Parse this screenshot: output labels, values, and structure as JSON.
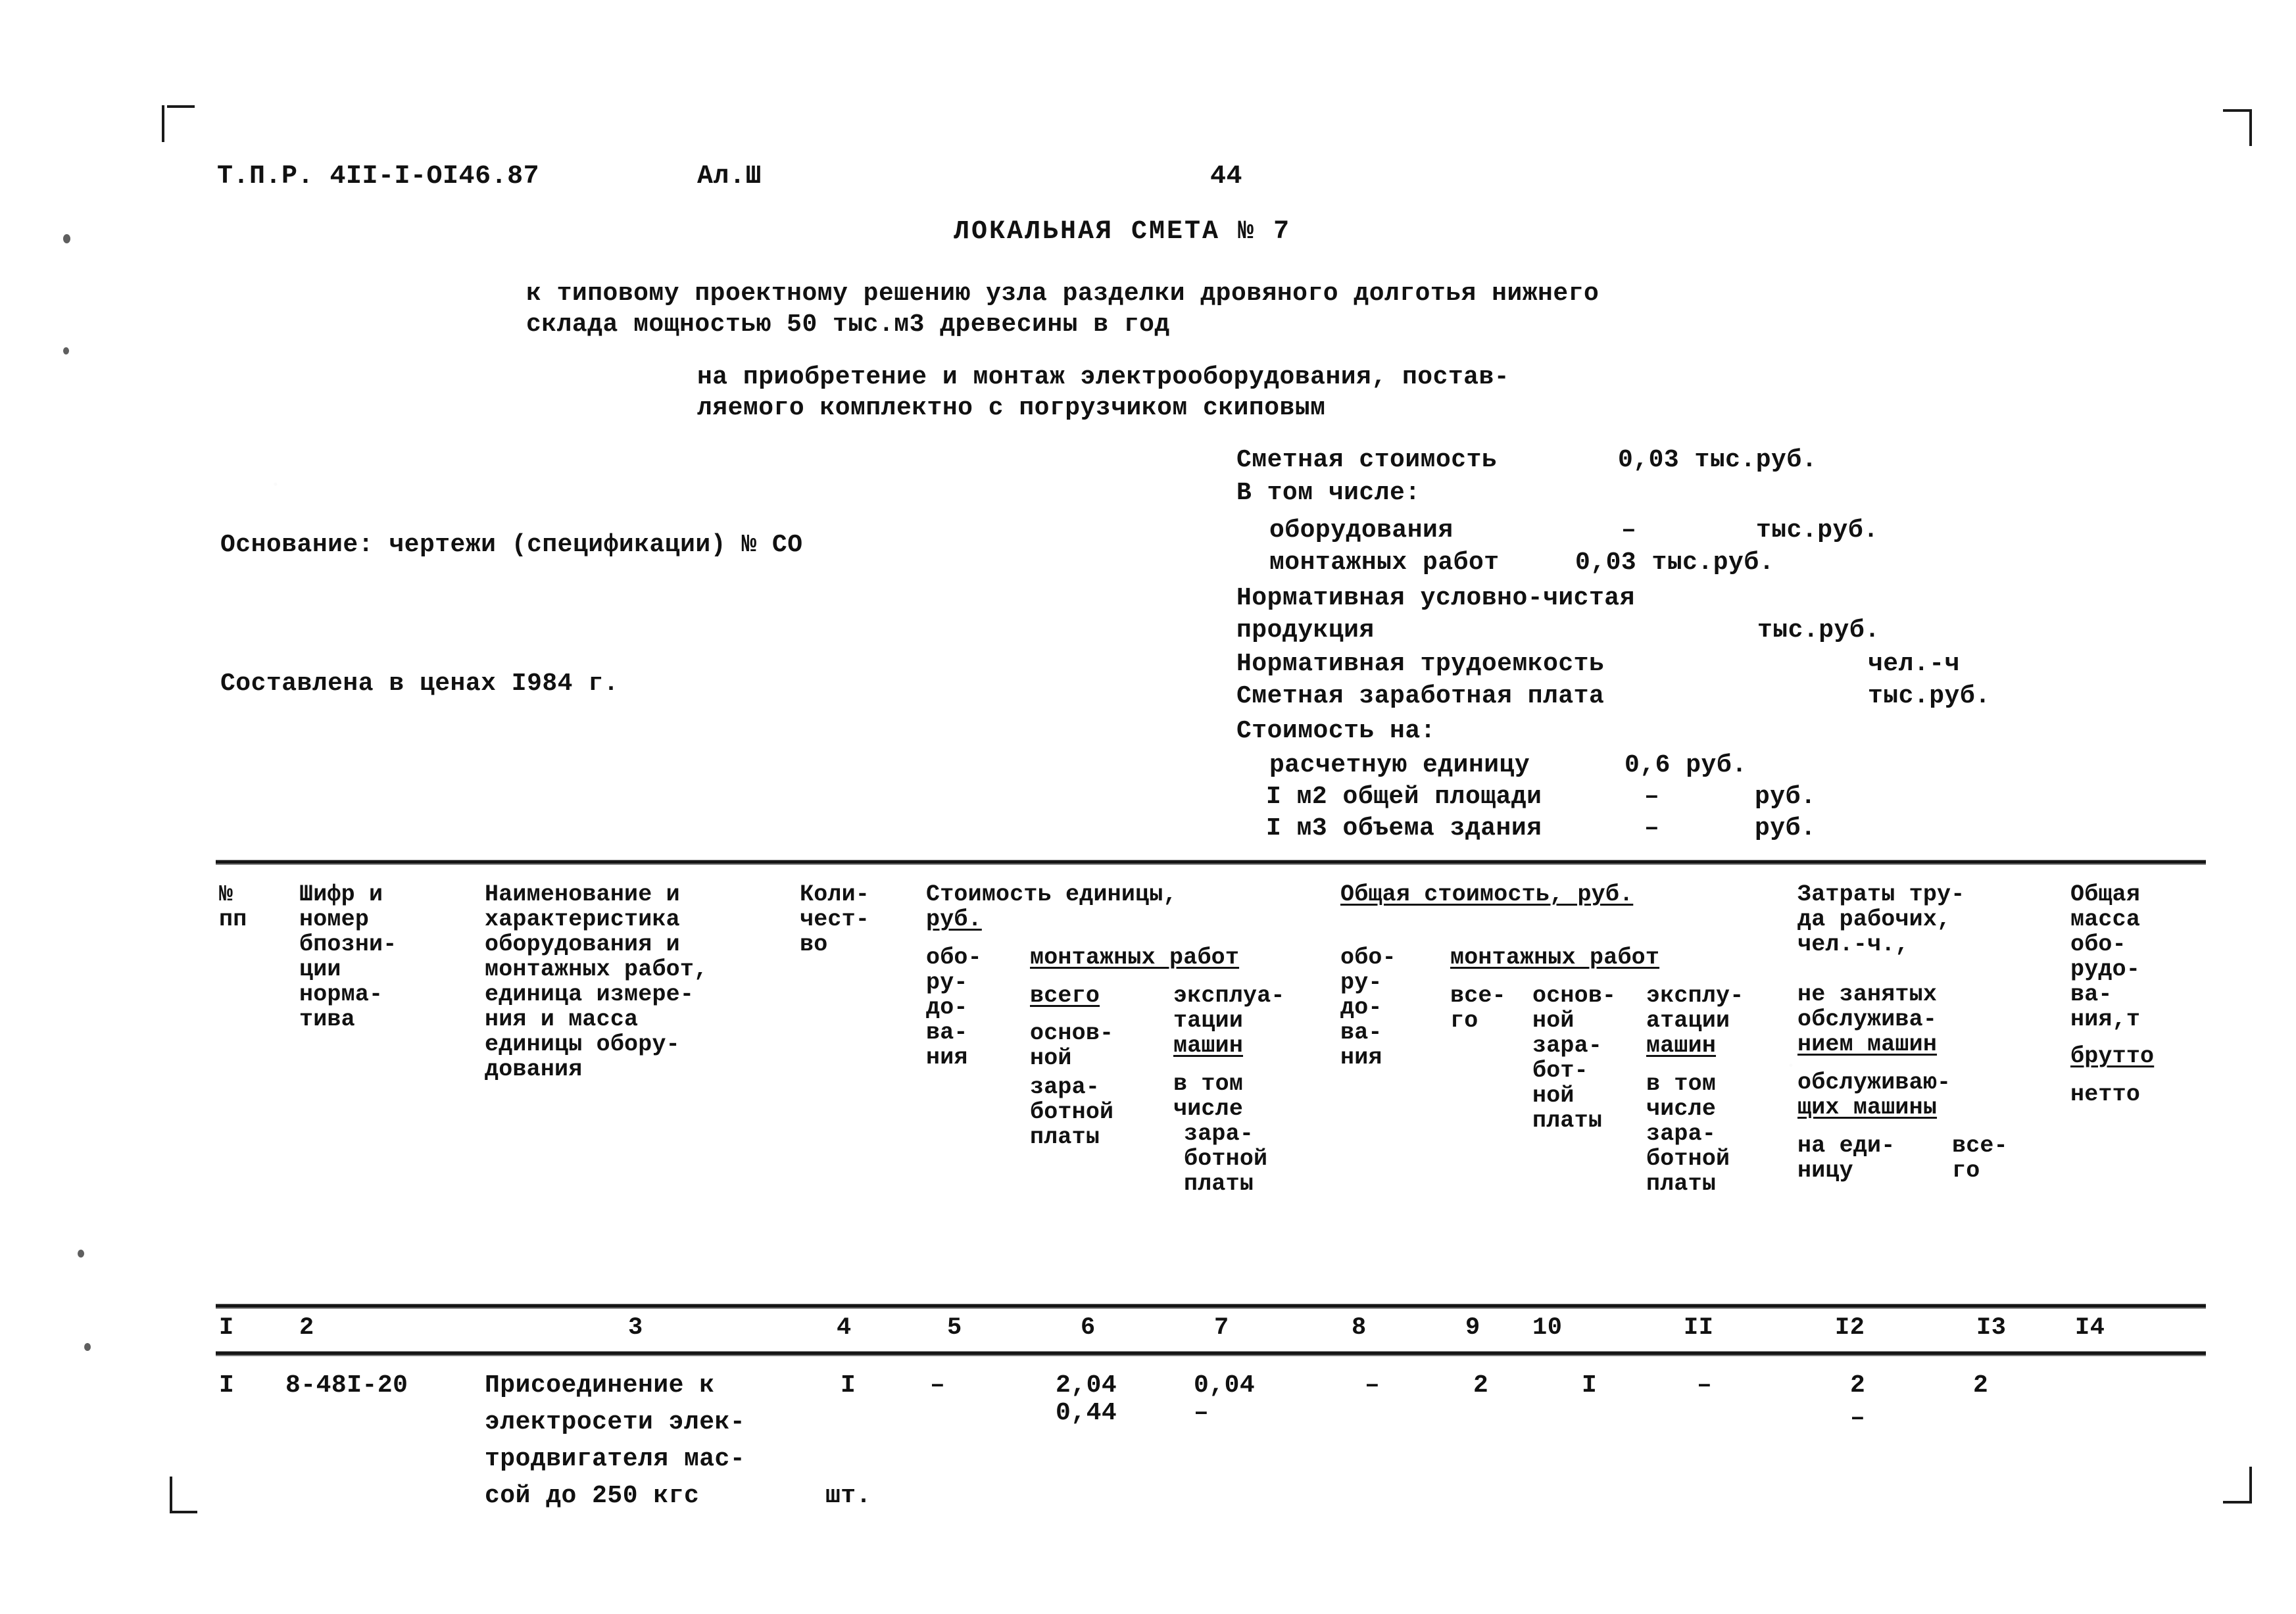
{
  "document": {
    "code": "Т.П.Р. 4II-I-OI46.87",
    "album": "Ал.Ш",
    "page_number": "44",
    "title": "ЛОКАЛЬНАЯ СМЕТА № 7",
    "subtitle_lines": [
      "к типовому проектному решению узла разделки дровяного долготья нижнего",
      "склада мощностью 50 тыс.м3 древесины в год"
    ],
    "purpose_lines": [
      "на приобретение и монтаж электрооборудования, постав-",
      "ляемого комплектно с погрузчиком скиповым"
    ],
    "basis": "Основание: чертежи (спецификации) № СО",
    "prices": "Составлена в ценах I984 г."
  },
  "summary": {
    "total_label": "Сметная стоимость",
    "total_value": "0,03 тыс.руб.",
    "including_label": "В том числе:",
    "equipment_label": "оборудования",
    "equipment_value": "–",
    "equipment_unit": "тыс.руб.",
    "install_label": "монтажных работ",
    "install_value": "0,03 тыс.руб.",
    "ncp_label_1": "Нормативная условно-чистая",
    "ncp_label_2": "продукция",
    "ncp_unit": "тыс.руб.",
    "labor_label": "Нормативная трудоемкость",
    "labor_unit": "чел.-ч",
    "wage_label": "Сметная заработная плата",
    "wage_unit": "тыс.руб.",
    "cost_on_label": "Стоимость на:",
    "unit_calc_label": "расчетную единицу",
    "unit_calc_value": "0,6 руб.",
    "area_label": "I м2 общей площади",
    "area_value": "–",
    "area_unit": "руб.",
    "volume_label": "I м3 объема здания",
    "volume_value": "–",
    "volume_unit": "руб."
  },
  "table": {
    "header": {
      "c1": [
        "№",
        "пп"
      ],
      "c2": [
        "Шифр и",
        "номер",
        "бпозни-",
        "ции",
        "норма-",
        "тива"
      ],
      "c3": [
        "Наименование и",
        "характеристика",
        "оборудования и",
        "монтажных работ,",
        "единица измере-",
        "ния и масса",
        "единицы обору-",
        "дования"
      ],
      "c4": [
        "Коли-",
        "чест-",
        "во"
      ],
      "group_unit_cost": "Стоимость единицы,",
      "group_unit_cost_2": "руб.",
      "c5": [
        "обо-",
        "ру-",
        "до-",
        "ва-",
        "ния"
      ],
      "group_install_1": "монтажных работ",
      "c6": [
        "всего",
        "основ-",
        "ной",
        "зара-",
        "ботной",
        "платы"
      ],
      "c7": [
        "эксплуа-",
        "тации",
        "машин",
        "в том",
        "числе",
        "зара-",
        "ботной",
        "платы"
      ],
      "group_total_cost": "Общая стоимость, руб.",
      "c8": [
        "обо-",
        "ру-",
        "до-",
        "ва-",
        "ния"
      ],
      "group_install_2": "монтажных работ",
      "c9": [
        "все-",
        "го"
      ],
      "c10": [
        "основ-",
        "ной",
        "зара-",
        "бот-",
        "ной",
        "платы"
      ],
      "c11": [
        "эксплу-",
        "атации",
        "машин",
        "в том",
        "числе",
        "зара-",
        "ботной",
        "платы"
      ],
      "c12": [
        "Затраты тру-",
        "да рабочих,",
        "чел.-ч.,",
        "не занятых",
        "обслужива-",
        "нием машин",
        "обслуживаю-",
        "щих машины",
        "на еди-",
        "ницу"
      ],
      "c13": [
        "все-",
        "го"
      ],
      "c14": [
        "Общая",
        "масса",
        "обо-",
        "рудо-",
        "ва-",
        "ния,т",
        "брутто",
        "нетто"
      ]
    },
    "column_numbers": [
      "I",
      "2",
      "3",
      "4",
      "5",
      "6",
      "7",
      "8",
      "9",
      "10",
      "II",
      "I2",
      "I3",
      "I4"
    ],
    "rows": [
      {
        "n": "I",
        "code": "8-48I-20",
        "description": [
          "Присоединение к",
          "электросети элек-",
          "тродвигателя мас-",
          "сой до 250 кгс"
        ],
        "unit": "шт.",
        "qty": "I",
        "c5": "–",
        "c6_top": "2,04",
        "c6_bottom": "0,44",
        "c7_top": "0,04",
        "c7_bottom": "–",
        "c8": "–",
        "c9": "2",
        "c10": "I",
        "c11": "–",
        "c12_top": "2",
        "c12_bottom": "–",
        "c13": "2",
        "c14": ""
      }
    ]
  }
}
